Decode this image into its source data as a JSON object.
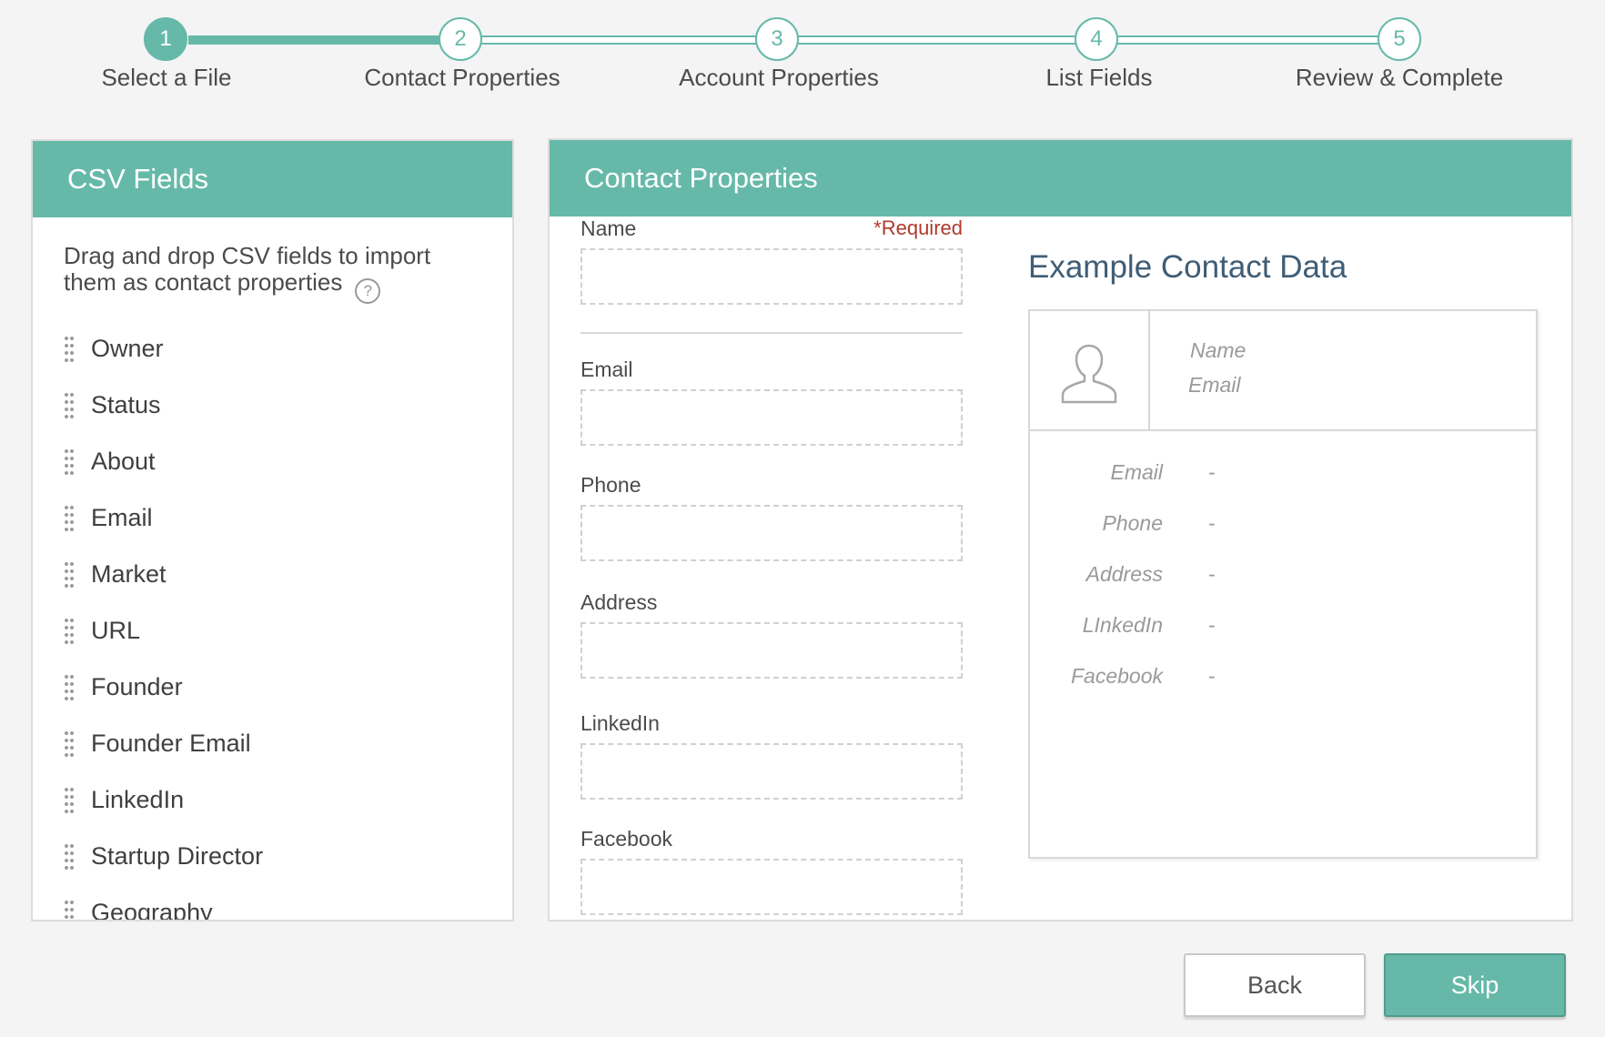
{
  "stepper": {
    "steps": [
      {
        "number": "1",
        "label": "Select a File",
        "state": "active"
      },
      {
        "number": "2",
        "label": "Contact Properties",
        "state": "current"
      },
      {
        "number": "3",
        "label": "Account Properties",
        "state": "todo"
      },
      {
        "number": "4",
        "label": "List Fields",
        "state": "todo"
      },
      {
        "number": "5",
        "label": "Review & Complete",
        "state": "todo"
      }
    ]
  },
  "csv_panel": {
    "title": "CSV Fields",
    "description": "Drag and drop CSV fields to import them as contact properties",
    "help_icon": "?",
    "fields": [
      "Owner",
      "Status",
      "About",
      "Email",
      "Market",
      "URL",
      "Founder",
      "Founder Email",
      "LinkedIn",
      "Startup Director",
      "Geography"
    ]
  },
  "contact_panel": {
    "title": "Contact Properties",
    "required_label": "*Required",
    "fields": [
      "Name",
      "Email",
      "Phone",
      "Address",
      "LinkedIn",
      "Facebook"
    ]
  },
  "example": {
    "title": "Example Contact Data",
    "name_placeholder": "Name",
    "email_placeholder": "Email",
    "rows": [
      {
        "label": "Email",
        "value": "-"
      },
      {
        "label": "Phone",
        "value": "-"
      },
      {
        "label": "Address",
        "value": "-"
      },
      {
        "label": "LInkedIn",
        "value": "-"
      },
      {
        "label": "Facebook",
        "value": "-"
      }
    ]
  },
  "buttons": {
    "back": "Back",
    "skip": "Skip"
  },
  "colors": {
    "accent": "#66b9a9",
    "required": "#b03a2e",
    "example_title": "#3f5d76"
  }
}
